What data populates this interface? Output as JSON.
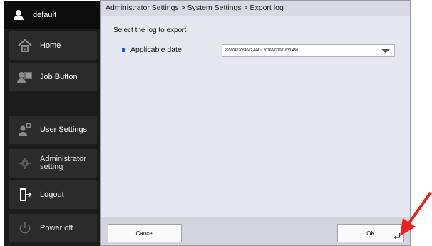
{
  "sidebar": {
    "user": {
      "label": "default",
      "icon": "user-icon"
    },
    "items": [
      {
        "label": "Home",
        "icon": "home-icon"
      },
      {
        "label": "Job Button",
        "icon": "job-button-icon"
      },
      {
        "label": "User Settings",
        "icon": "user-settings-icon"
      },
      {
        "label": "Administrator setting",
        "icon": "gear-icon"
      },
      {
        "label": "Logout",
        "icon": "logout-icon"
      },
      {
        "label": "Power off",
        "icon": "power-icon"
      }
    ]
  },
  "main": {
    "breadcrumb": "Administrator Settings > System Settings > Export log",
    "prompt": "Select the log to export.",
    "field": {
      "label": "Applicable date",
      "value": "20160427064042.444 ~ 20160427081633.450"
    }
  },
  "footer": {
    "cancel_label": "Cancel",
    "ok_label": "OK"
  },
  "colors": {
    "bullet": "#2255cc",
    "annotation_arrow": "#e8231f"
  }
}
